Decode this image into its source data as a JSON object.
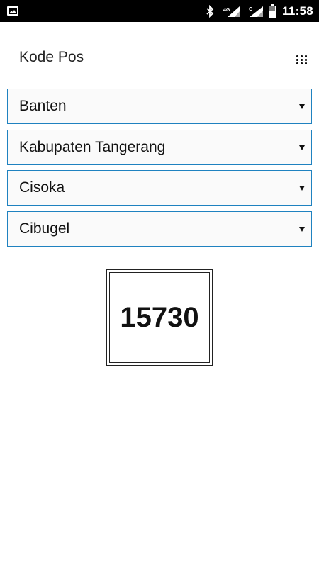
{
  "status_bar": {
    "time": "11:58",
    "network_1": "4G",
    "network_2": "G",
    "icons": [
      "gallery-icon",
      "bluetooth-icon",
      "signal-4g-icon",
      "signal-g-icon",
      "battery-icon"
    ]
  },
  "header": {
    "title": "Kode Pos",
    "menu_icon": "dots-grid-icon"
  },
  "selects": {
    "province": "Banten",
    "regency": "Kabupaten Tangerang",
    "district": "Cisoka",
    "village": "Cibugel"
  },
  "result": {
    "postal_code": "15730"
  },
  "colors": {
    "select_border": "#1f82c0",
    "status_bar_bg": "#000000"
  }
}
